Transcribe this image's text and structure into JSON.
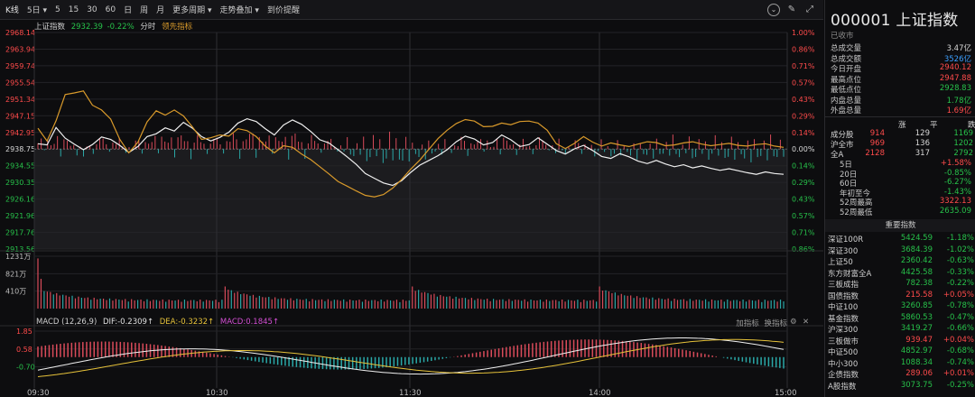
{
  "toolbar": {
    "items": [
      "K线",
      "5日 ▾",
      "5",
      "15",
      "30",
      "60",
      "日",
      "周",
      "月",
      "更多周期 ▾",
      "走势叠加 ▾",
      "到价提醒"
    ],
    "icons": [
      "chevron-down-icon",
      "pen-icon",
      "expand-icon"
    ]
  },
  "header_line": {
    "name": "上证指数",
    "price": "2932.39",
    "change": "-0.22%",
    "mode": "分时",
    "lead": "领先指标"
  },
  "colors": {
    "up": "#ff4b4b",
    "down": "#27c14a",
    "index_line": "#f0f0f0",
    "lead_line": "#d99a2b",
    "dif": "#f0f0f0",
    "dea": "#e6c23a",
    "macd_label": "#d44fd4",
    "bar_down": "#2aa7a7"
  },
  "chart_data": {
    "type": "line",
    "time_ticks": [
      "09:30",
      "10:30",
      "11:30",
      "14:00",
      "15:00"
    ],
    "price_axis": [
      "2968.14",
      "2963.94",
      "2959.74",
      "2955.54",
      "2951.34",
      "2947.15",
      "2942.95",
      "2938.75",
      "2934.55",
      "2930.35",
      "2926.16",
      "2921.96",
      "2917.76",
      "2913.56"
    ],
    "pct_axis": [
      "1.00%",
      "0.86%",
      "0.71%",
      "0.57%",
      "0.43%",
      "0.29%",
      "0.14%",
      "0.00%",
      "0.14%",
      "0.29%",
      "0.43%",
      "0.57%",
      "0.71%",
      "0.86%"
    ],
    "ylim": [
      2913.56,
      2968.14
    ],
    "prev_close": 2938.75,
    "series": [
      {
        "name": "上证指数",
        "values": [
          2940.1,
          2939.8,
          2944.2,
          2941.5,
          2940.0,
          2938.6,
          2939.9,
          2941.8,
          2941.2,
          2939.7,
          2937.9,
          2939.4,
          2941.9,
          2942.6,
          2944.1,
          2943.3,
          2945.5,
          2944.0,
          2941.9,
          2940.8,
          2941.7,
          2943.0,
          2945.3,
          2946.4,
          2945.7,
          2943.9,
          2942.3,
          2944.8,
          2946.1,
          2945.0,
          2943.2,
          2941.1,
          2940.3,
          2938.6,
          2936.8,
          2934.9,
          2932.6,
          2931.4,
          2930.2,
          2929.6,
          2930.8,
          2932.9,
          2934.7,
          2935.9,
          2937.1,
          2938.6,
          2940.6,
          2942.0,
          2941.3,
          2939.8,
          2940.4,
          2942.3,
          2941.1,
          2939.4,
          2939.9,
          2941.6,
          2940.0,
          2938.4,
          2937.5,
          2938.8,
          2939.7,
          2938.4,
          2936.9,
          2936.4,
          2937.6,
          2936.8,
          2935.7,
          2935.1,
          2935.9,
          2935.0,
          2934.3,
          2934.8,
          2934.0,
          2934.5,
          2933.9,
          2933.4,
          2933.8,
          2933.3,
          2932.8,
          2932.4,
          2933.0,
          2932.6,
          2932.39
        ]
      },
      {
        "name": "领先指标",
        "values": [
          2944.0,
          2940.8,
          2945.9,
          2952.5,
          2952.9,
          2953.4,
          2949.8,
          2948.6,
          2946.3,
          2941.2,
          2937.8,
          2940.5,
          2945.6,
          2948.4,
          2947.3,
          2948.6,
          2947.1,
          2944.3,
          2941.2,
          2941.6,
          2942.3,
          2942.0,
          2943.9,
          2943.4,
          2941.9,
          2939.5,
          2937.8,
          2939.6,
          2939.2,
          2937.5,
          2936.1,
          2934.3,
          2932.5,
          2930.6,
          2929.4,
          2928.2,
          2927.1,
          2926.7,
          2927.3,
          2928.9,
          2931.1,
          2933.7,
          2936.0,
          2938.7,
          2941.4,
          2943.5,
          2945.2,
          2946.2,
          2945.8,
          2944.4,
          2944.5,
          2945.3,
          2944.9,
          2945.7,
          2945.8,
          2945.3,
          2943.5,
          2940.1,
          2938.9,
          2940.2,
          2941.9,
          2940.5,
          2939.5,
          2940.3,
          2939.8,
          2939.4,
          2940.0,
          2940.6,
          2940.4,
          2939.6,
          2939.8,
          2940.3,
          2940.6,
          2940.0,
          2939.6,
          2939.9,
          2940.2,
          2939.7,
          2939.5,
          2939.9,
          2940.1,
          2939.5,
          2939.2
        ]
      }
    ],
    "volume_axis": [
      "1231万",
      "821万",
      "410万"
    ],
    "volume_max": 1231,
    "macd": {
      "label": "MACD (12,26,9)",
      "dif_label": "DIF:-0.2309",
      "dea_label": "DEA:-0.3232",
      "macd_label": "MACD:0.1845",
      "axis": [
        "1.85",
        "0.58",
        "-0.70"
      ],
      "ylim": [
        -2.2,
        1.85
      ]
    }
  },
  "macd_controls": [
    "加指标",
    "换指标"
  ],
  "side": {
    "code_title": "000001 上证指数",
    "status": "已收市",
    "stats": [
      {
        "k": "总成交量",
        "v": "3.47亿",
        "c": "white"
      },
      {
        "k": "总成交额",
        "v": "3526亿",
        "c": "blue"
      },
      {
        "k": "今日开盘",
        "v": "2940.12",
        "c": "red"
      },
      {
        "k": "最高点位",
        "v": "2947.88",
        "c": "red"
      },
      {
        "k": "最低点位",
        "v": "2928.83",
        "c": "green"
      },
      {
        "k": "内盘总量",
        "v": "1.78亿",
        "c": "green"
      },
      {
        "k": "外盘总量",
        "v": "1.69亿",
        "c": "red"
      }
    ],
    "breadth_header": [
      "涨",
      "平",
      "跌"
    ],
    "breadth": [
      {
        "k": "成分股",
        "up": "914",
        "flat": "129",
        "down": "1169"
      },
      {
        "k": "沪全市",
        "up": "969",
        "flat": "136",
        "down": "1202"
      },
      {
        "k": "全A",
        "up": "2128",
        "flat": "317",
        "down": "2792"
      }
    ],
    "periods": [
      {
        "k": "5日",
        "v": "+1.58%",
        "c": "red"
      },
      {
        "k": "20日",
        "v": "-0.85%",
        "c": "green"
      },
      {
        "k": "60日",
        "v": "-6.27%",
        "c": "green"
      },
      {
        "k": "年初至今",
        "v": "-1.43%",
        "c": "green"
      },
      {
        "k": "52周最高",
        "v": "3322.13",
        "c": "red"
      },
      {
        "k": "52周最低",
        "v": "2635.09",
        "c": "green"
      }
    ],
    "important_title": "重要指数",
    "important": [
      {
        "n": "深证100R",
        "p": "5424.59",
        "c": "-1.18%",
        "d": "green"
      },
      {
        "n": "深证300",
        "p": "3684.39",
        "c": "-1.02%",
        "d": "green"
      },
      {
        "n": "上证50",
        "p": "2360.42",
        "c": "-0.63%",
        "d": "green"
      },
      {
        "n": "东方财富全A",
        "p": "4425.58",
        "c": "-0.33%",
        "d": "green"
      },
      {
        "n": "三板成指",
        "p": "782.38",
        "c": "-0.22%",
        "d": "green"
      },
      {
        "n": "国债指数",
        "p": "215.58",
        "c": "+0.05%",
        "d": "red"
      },
      {
        "n": "中证100",
        "p": "3260.85",
        "c": "-0.78%",
        "d": "green"
      },
      {
        "n": "基金指数",
        "p": "5860.53",
        "c": "-0.47%",
        "d": "green"
      },
      {
        "n": "沪深300",
        "p": "3419.27",
        "c": "-0.66%",
        "d": "green"
      },
      {
        "n": "三板做市",
        "p": "939.47",
        "c": "+0.04%",
        "d": "red"
      },
      {
        "n": "中证500",
        "p": "4852.97",
        "c": "-0.68%",
        "d": "green"
      },
      {
        "n": "中小300",
        "p": "1088.34",
        "c": "-0.74%",
        "d": "green"
      },
      {
        "n": "企债指数",
        "p": "289.06",
        "c": "+0.01%",
        "d": "red"
      },
      {
        "n": "A股指数",
        "p": "3073.75",
        "c": "-0.25%",
        "d": "green"
      }
    ]
  }
}
